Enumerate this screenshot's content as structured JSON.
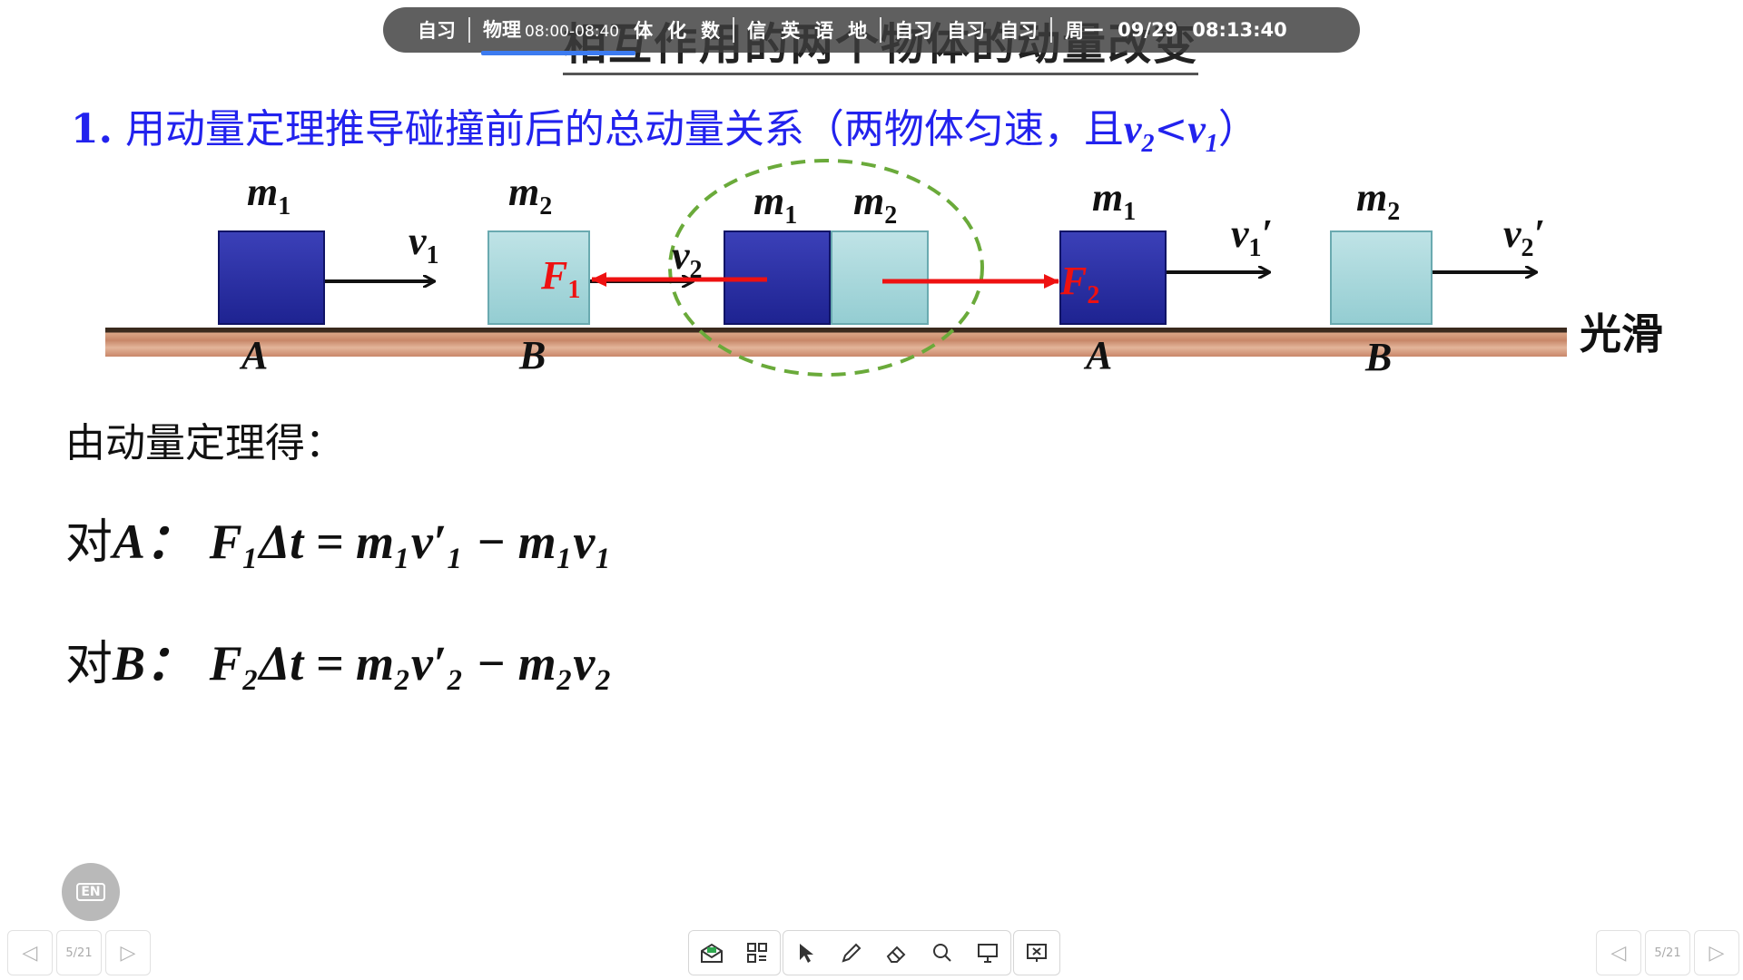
{
  "status_bar": {
    "current_label": "自习",
    "current_subject": "物理",
    "current_time_range": "08:00-08:40",
    "upcoming": [
      "体",
      "化",
      "数"
    ],
    "group2": [
      "信",
      "英",
      "语",
      "地"
    ],
    "group3": [
      "自习",
      "自习",
      "自习"
    ],
    "weekday": "周一",
    "date": "09/29",
    "clock": "08:13:40"
  },
  "slide": {
    "title": "相互作用的两个物体的动量改变",
    "question_number": "1.",
    "question_text": "用动量定理推导碰撞前后的总动量关系（两物体匀速，且",
    "question_cond_v2": "v",
    "question_cond_sub2": "2",
    "question_cond_lt": "<",
    "question_cond_v1": "v",
    "question_cond_sub1": "1",
    "question_close": "）",
    "smooth_label": "光滑",
    "intro": "由动量定理得：",
    "eq_a_prefix": "对",
    "eq_a_body": "A：",
    "eq_b_prefix": "对",
    "eq_b_body": "B：",
    "eq_a_formula": "F₁Δt = m₁v′₁ − m₁v₁",
    "eq_b_formula": "F₂Δt = m₂v′₂ − m₂v₂"
  },
  "diagram_labels": {
    "m1": "m",
    "m2": "m",
    "sub1": "1",
    "sub2": "2",
    "v": "v",
    "F": "F",
    "A": "A",
    "B": "B",
    "prime": "′"
  },
  "bottom": {
    "lang_button": "EN",
    "page_indicator": "5/21",
    "prev_icon": "◁",
    "next_icon": "▷"
  },
  "colors": {
    "question_blue": "#2222ee",
    "force_red": "#ee1111",
    "block_dark": "#1e2391",
    "block_light": "#94cdd2",
    "circle_green": "#6aaa3a"
  }
}
